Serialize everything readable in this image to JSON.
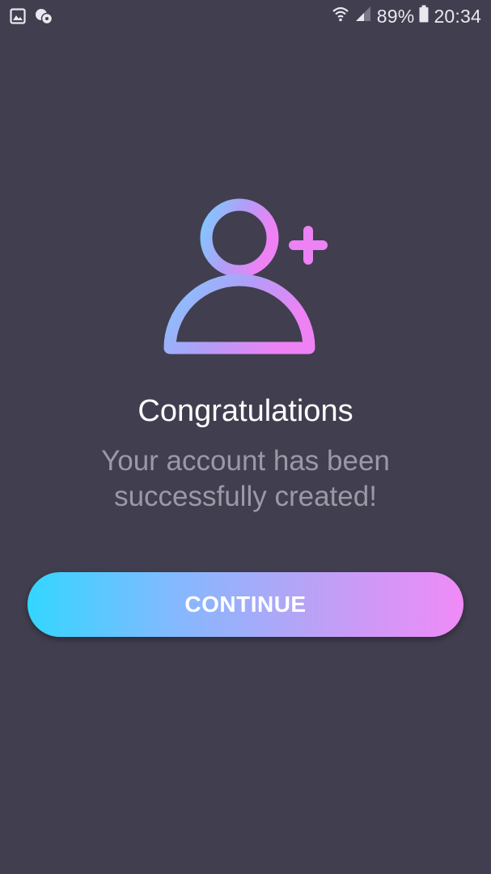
{
  "status_bar": {
    "left_icons": [
      "gallery-icon",
      "chat-notification-icon"
    ],
    "battery_percent": "89%",
    "time": "20:34",
    "right_icons": [
      "wifi-icon",
      "signal-icon",
      "battery-icon"
    ]
  },
  "hero": {
    "icon": "add-user-icon",
    "gradient_colors": [
      "#7fc9ff",
      "#ee82f5"
    ]
  },
  "message": {
    "title": "Congratulations",
    "subtitle": "Your account has been successfully created!"
  },
  "actions": {
    "continue_label": "CONTINUE"
  },
  "colors": {
    "background": "#413e4f",
    "button_gradient_start": "#33d6ff",
    "button_gradient_end": "#f08af7",
    "subtitle_text": "#9b99a6"
  }
}
